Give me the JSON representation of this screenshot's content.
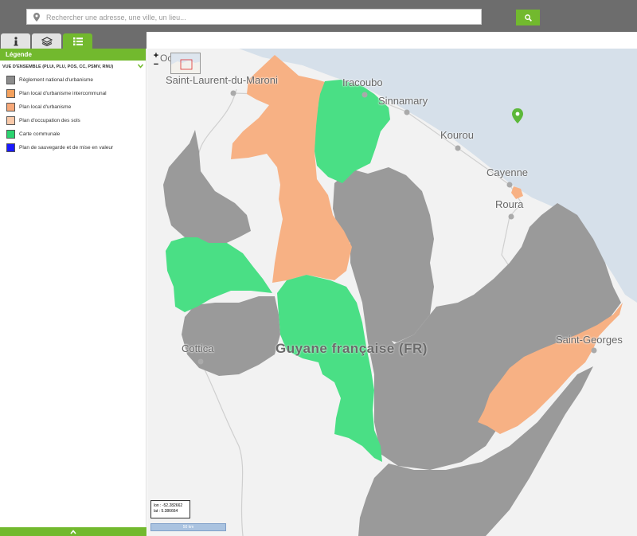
{
  "search": {
    "placeholder": "Rechercher une adresse, une ville, un lieu..."
  },
  "tabs": [
    {
      "icon": "info-icon"
    },
    {
      "icon": "layers-icon"
    },
    {
      "icon": "legend-list-icon",
      "active": true
    }
  ],
  "legend": {
    "title": "Légende",
    "section_title": "VUE D'ENSEMBLE (PLUi, PLU, POS, CC, PSMV, RNU)",
    "items": [
      {
        "label": "Règlement national d'urbanisme",
        "color": "#8c8c8c"
      },
      {
        "label": "Plan local d'urbanisme intercommunal",
        "color": "#f4a15d"
      },
      {
        "label": "Plan local d'urbanisme",
        "color": "#f7a878"
      },
      {
        "label": "Plan d'occupation des sols",
        "color": "#f9c9a9"
      },
      {
        "label": "Carte communale",
        "color": "#2bd36f"
      },
      {
        "label": "Plan de sauvegarde et de mise en valeur",
        "color": "#1a1aff"
      }
    ]
  },
  "map": {
    "places": [
      {
        "name": "Saint-Laurent-du-Maroni"
      },
      {
        "name": "Iracoubo"
      },
      {
        "name": "Sinnamary"
      },
      {
        "name": "Kourou"
      },
      {
        "name": "Cayenne"
      },
      {
        "name": "Roura"
      },
      {
        "name": "Saint-Georges"
      },
      {
        "name": "Cottica"
      }
    ],
    "region_label": "Guyane française (FR)",
    "edge_label": "Oc",
    "zoom_in": "+",
    "zoom_out": "−",
    "coords": {
      "lon": "lon : -52.282662",
      "lat": "lat : 5.386664"
    },
    "scale": "50 km",
    "colors": {
      "sea": "#d6e0ea",
      "land": "#f2f2f2",
      "rnu": "#9a9a9a",
      "plu": "#f7b184",
      "cc": "#4adf85",
      "marker": "#5cb83a"
    }
  }
}
